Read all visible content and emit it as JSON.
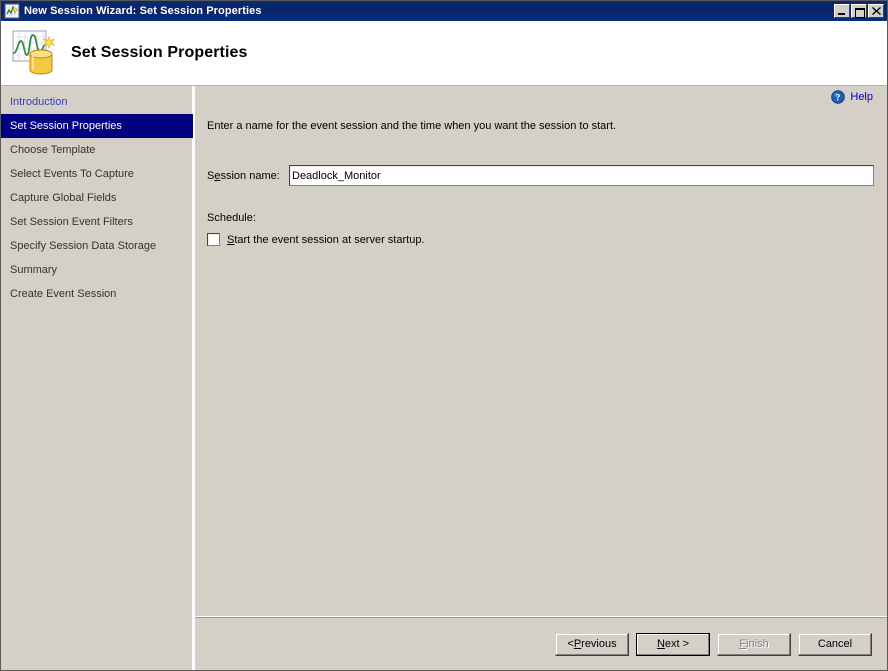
{
  "window": {
    "title": "New Session Wizard: Set Session Properties",
    "icon": "wizard-icon",
    "minimize_label": "_",
    "maximize_label": "□",
    "close_label": "✕"
  },
  "header": {
    "title": "Set Session Properties",
    "icon": "session-chart-database-icon"
  },
  "sidebar": {
    "items": [
      {
        "label": "Introduction",
        "state": "link"
      },
      {
        "label": "Set Session Properties",
        "state": "active"
      },
      {
        "label": "Choose Template",
        "state": "normal"
      },
      {
        "label": "Select Events To Capture",
        "state": "normal"
      },
      {
        "label": "Capture Global Fields",
        "state": "normal"
      },
      {
        "label": "Set Session Event Filters",
        "state": "normal"
      },
      {
        "label": "Specify Session Data Storage",
        "state": "normal"
      },
      {
        "label": "Summary",
        "state": "normal"
      },
      {
        "label": "Create Event Session",
        "state": "normal"
      }
    ]
  },
  "content": {
    "help_label": "Help",
    "help_icon": "help-question-icon",
    "instruction": "Enter a name for the event session and the time when you want the session to start.",
    "session_name_label_pre": "S",
    "session_name_label_mnemonic": "e",
    "session_name_label_post": "ssion name:",
    "session_name_value": "Deadlock_Monitor",
    "session_name_placeholder": "",
    "schedule_label": "Schedule:",
    "startup_checkbox_mnemonic": "S",
    "startup_checkbox_label_post": "tart the event session at server startup.",
    "startup_checkbox_checked": false
  },
  "footer": {
    "buttons": [
      {
        "label_pre": "< ",
        "mnemonic": "P",
        "label_post": "revious",
        "state": "normal",
        "name": "previous-button"
      },
      {
        "label_pre": "",
        "mnemonic": "N",
        "label_post": "ext >",
        "state": "default",
        "name": "next-button"
      },
      {
        "label_pre": "",
        "mnemonic": "F",
        "label_post": "inish",
        "state": "disabled",
        "name": "finish-button"
      },
      {
        "label_pre": "",
        "mnemonic": "",
        "label_post": "Cancel",
        "state": "normal",
        "name": "cancel-button"
      }
    ]
  },
  "colors": {
    "titlebar": "#0a246a",
    "face": "#d4d0c8",
    "highlight": "#000080",
    "link": "#0000cc",
    "sidebar_link": "#3b3bb5"
  }
}
